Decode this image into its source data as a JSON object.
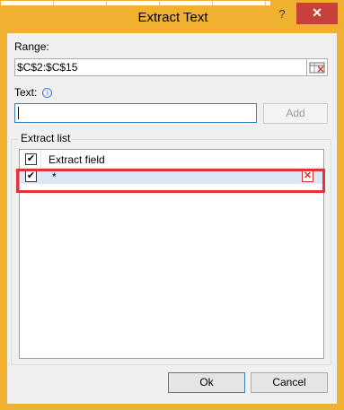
{
  "window": {
    "title": "Extract Text",
    "help_glyph": "?",
    "close_glyph": "✕",
    "frame_color": "#f0b030",
    "close_color": "#c7413a"
  },
  "range": {
    "label": "Range:",
    "value": "$C$2:$C$15",
    "select_icon": "range-select-icon"
  },
  "text": {
    "label": "Text:",
    "info_glyph": "i",
    "value": "",
    "add_label": "Add"
  },
  "extract_list": {
    "group_label": "Extract list",
    "header": {
      "label": "Extract field",
      "checked": "✔"
    },
    "rows": [
      {
        "text": "*",
        "checked": "✔",
        "delete_glyph": "✕"
      }
    ],
    "highlight_color": "#e0333a"
  },
  "buttons": {
    "ok_label": "Ok",
    "cancel_label": "Cancel"
  }
}
